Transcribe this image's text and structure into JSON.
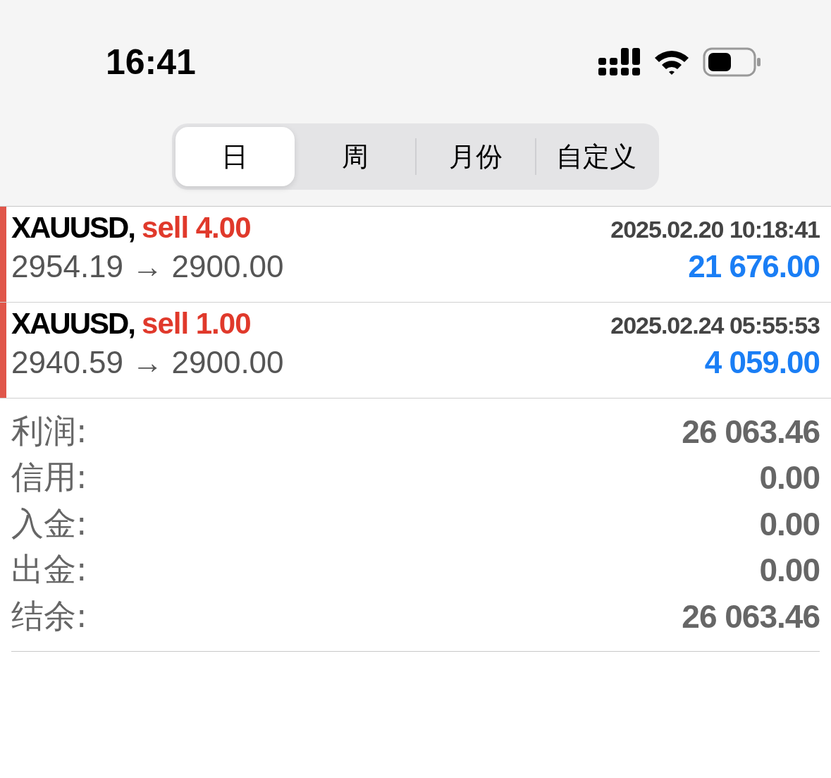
{
  "status_bar": {
    "time": "16:41"
  },
  "tabs": [
    {
      "label": "日",
      "selected": true
    },
    {
      "label": "周",
      "selected": false
    },
    {
      "label": "月份",
      "selected": false
    },
    {
      "label": "自定义",
      "selected": false
    }
  ],
  "trades": [
    {
      "kind": "sell",
      "symbol": "XAUUSD,",
      "order": "sell 4.00",
      "time": "2025.02.20 10:18:41",
      "prices": "2954.19 → 2900.00",
      "profit": "21 676.00"
    },
    {
      "kind": "sell",
      "symbol": "XAUUSD,",
      "order": "sell 1.00",
      "time": "2025.02.24 05:55:53",
      "prices": "2940.59 → 2900.00",
      "profit": "4 059.00"
    }
  ],
  "summary": [
    {
      "label": "利润:",
      "value": "26 063.46"
    },
    {
      "label": "信用:",
      "value": "0.00"
    },
    {
      "label": "入金:",
      "value": "0.00"
    },
    {
      "label": "出金:",
      "value": "0.00"
    },
    {
      "label": "结余:",
      "value": "26 063.46"
    }
  ]
}
